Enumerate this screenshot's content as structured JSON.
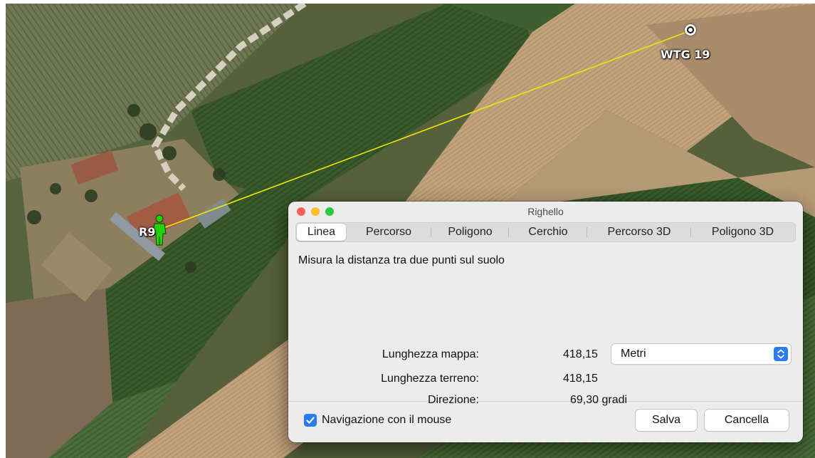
{
  "map": {
    "markers": [
      {
        "label": "WTG 19",
        "icon": "target-pin-icon"
      },
      {
        "label": "R9",
        "icon": "person-icon"
      }
    ],
    "line_color": "#f2e600"
  },
  "dialog": {
    "title": "Righello",
    "tabs": [
      "Linea",
      "Percorso",
      "Poligono",
      "Cerchio",
      "Percorso 3D",
      "Poligono 3D"
    ],
    "active_tab": "Linea",
    "description": "Misura la distanza tra due punti sul suolo",
    "fields": {
      "map_length_label": "Lunghezza mappa:",
      "map_length_value": "418,15",
      "ground_length_label": "Lunghezza terreno:",
      "ground_length_value": "418,15",
      "heading_label": "Direzione:",
      "heading_value": "69,30 gradi"
    },
    "unit_select": {
      "selected": "Metri"
    },
    "mouse_nav": {
      "label": "Navigazione con il mouse",
      "checked": true
    },
    "buttons": {
      "save": "Salva",
      "cancel": "Cancella"
    },
    "colors": {
      "accent": "#2b7cf2",
      "close": "#fe5f57",
      "minimize": "#febc2e",
      "zoom": "#28c840"
    }
  }
}
